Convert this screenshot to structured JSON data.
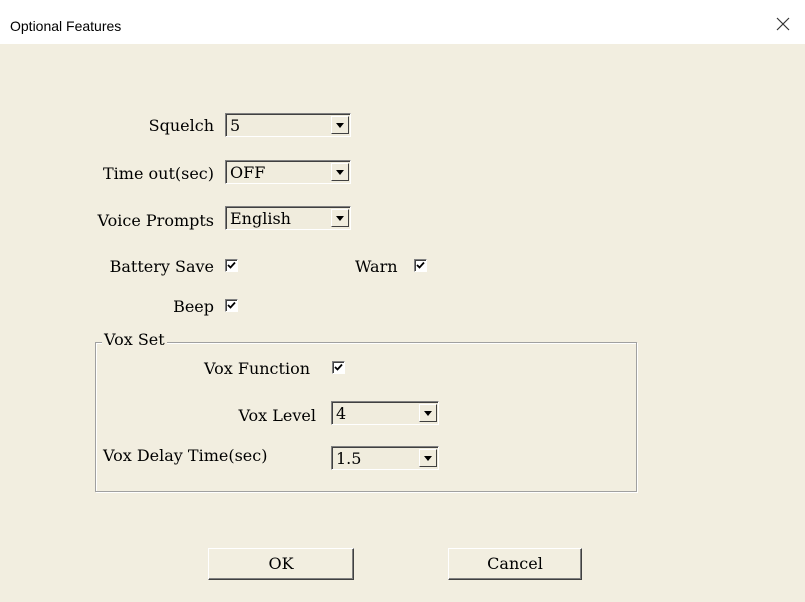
{
  "window": {
    "title": "Optional Features",
    "close_icon": "close-x-icon"
  },
  "fields": {
    "squelch": {
      "label": "Squelch",
      "value": "5"
    },
    "timeout": {
      "label": "Time out(sec)",
      "value": "OFF"
    },
    "voice_prompts": {
      "label": "Voice Prompts",
      "value": "English"
    },
    "battery_save": {
      "label": "Battery Save",
      "checked": true
    },
    "warn": {
      "label": "Warn",
      "checked": true
    },
    "beep": {
      "label": "Beep",
      "checked": true
    }
  },
  "vox": {
    "group_label": "Vox Set",
    "function": {
      "label": "Vox Function",
      "checked": true
    },
    "level": {
      "label": "Vox Level",
      "value": "4"
    },
    "delay": {
      "label": "Vox Delay Time(sec)",
      "value": "1.5"
    }
  },
  "buttons": {
    "ok": "OK",
    "cancel": "Cancel"
  }
}
